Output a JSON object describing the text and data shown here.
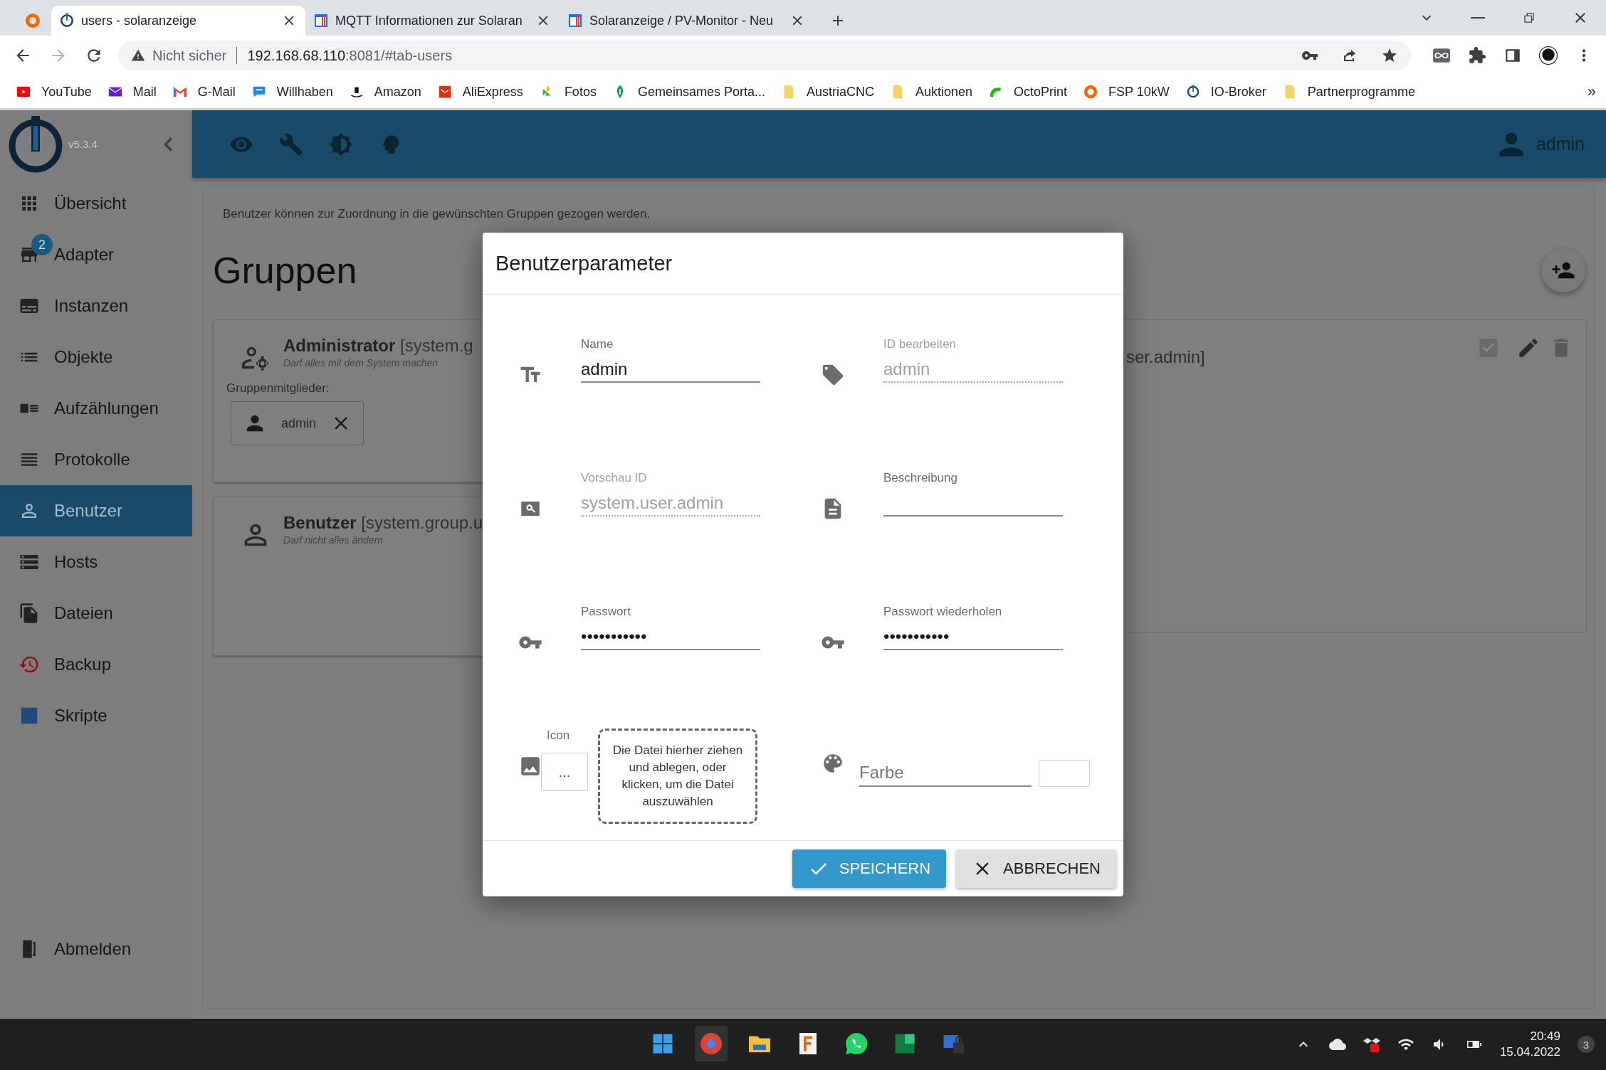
{
  "browser": {
    "tabs": [
      {
        "kind": "pinned",
        "selected": false
      },
      {
        "kind": "page",
        "title": "users - solaranzeige",
        "selected": true
      },
      {
        "kind": "page",
        "title": "MQTT Informationen zur Solaran",
        "selected": false
      },
      {
        "kind": "page",
        "title": "Solaranzeige / PV-Monitor - Neu",
        "selected": false
      }
    ],
    "address": {
      "security": "Nicht sicher",
      "host": "192.168.68.110",
      "path": ":8081/#tab-users"
    },
    "bookmarks": [
      "YouTube",
      "Mail",
      "G-Mail",
      "Willhaben",
      "Amazon",
      "AliExpress",
      "Fotos",
      "Gemeinsames Porta...",
      "AustriaCNC",
      "Auktionen",
      "OctoPrint",
      "FSP 10kW",
      "IO-Broker",
      "Partnerprogramme"
    ],
    "bookmarks_more": "»"
  },
  "app": {
    "version": "v5.3.4",
    "sidebar": {
      "items": [
        {
          "label": "Übersicht",
          "selected": false
        },
        {
          "label": "Adapter",
          "selected": false,
          "badge": "2"
        },
        {
          "label": "Instanzen",
          "selected": false
        },
        {
          "label": "Objekte",
          "selected": false
        },
        {
          "label": "Aufzählungen",
          "selected": false
        },
        {
          "label": "Protokolle",
          "selected": false
        },
        {
          "label": "Benutzer",
          "selected": true
        },
        {
          "label": "Hosts",
          "selected": false
        },
        {
          "label": "Dateien",
          "selected": false
        },
        {
          "label": "Backup",
          "selected": false
        },
        {
          "label": "Skripte",
          "selected": false
        }
      ],
      "logout": "Abmelden"
    },
    "header": {
      "user": "admin"
    },
    "page": {
      "hint": "Benutzer können zur Zuordnung in die gewünschten Gruppen gezogen werden.",
      "heading": "Gruppen",
      "groups": [
        {
          "name": "Administrator",
          "id": "[system.g",
          "description": "Darf alles mit dem System machen",
          "members_label": "Gruppenmitglieder:",
          "members": [
            "admin"
          ]
        },
        {
          "name": "Benutzer",
          "id": "[system.group.u",
          "description": "Darf nicht alles ändern"
        }
      ],
      "user_card": {
        "id_tail": "ser.admin]",
        "enabled": true
      }
    }
  },
  "dialog": {
    "title": "Benutzerparameter",
    "fields": [
      {
        "label": "Name",
        "value": "admin",
        "disabled": false
      },
      {
        "label": "ID bearbeiten",
        "value": "admin",
        "disabled": true
      },
      {
        "label": "Vorschau ID",
        "value": "system.user.admin",
        "disabled": true
      },
      {
        "label": "Beschreibung",
        "disabled": false
      },
      {
        "label": "Passwort",
        "value": "•••••••••••",
        "disabled": false
      },
      {
        "label": "Passwort wiederholen",
        "value": "•••••••••••",
        "disabled": false
      }
    ],
    "icon_picker": {
      "label": "Icon",
      "button": "...",
      "dropzone": "Die Datei hierher ziehen und ablegen, oder klicken, um die Datei auszuwählen"
    },
    "color_field": {
      "placeholder": "Farbe"
    },
    "buttons": [
      {
        "label": "SPEICHERN",
        "kind": "primary"
      },
      {
        "label": "ABBRECHEN",
        "kind": "secondary"
      }
    ]
  },
  "taskbar": {
    "time": "20:49",
    "date": "15.04.2022",
    "notifications": "3"
  }
}
